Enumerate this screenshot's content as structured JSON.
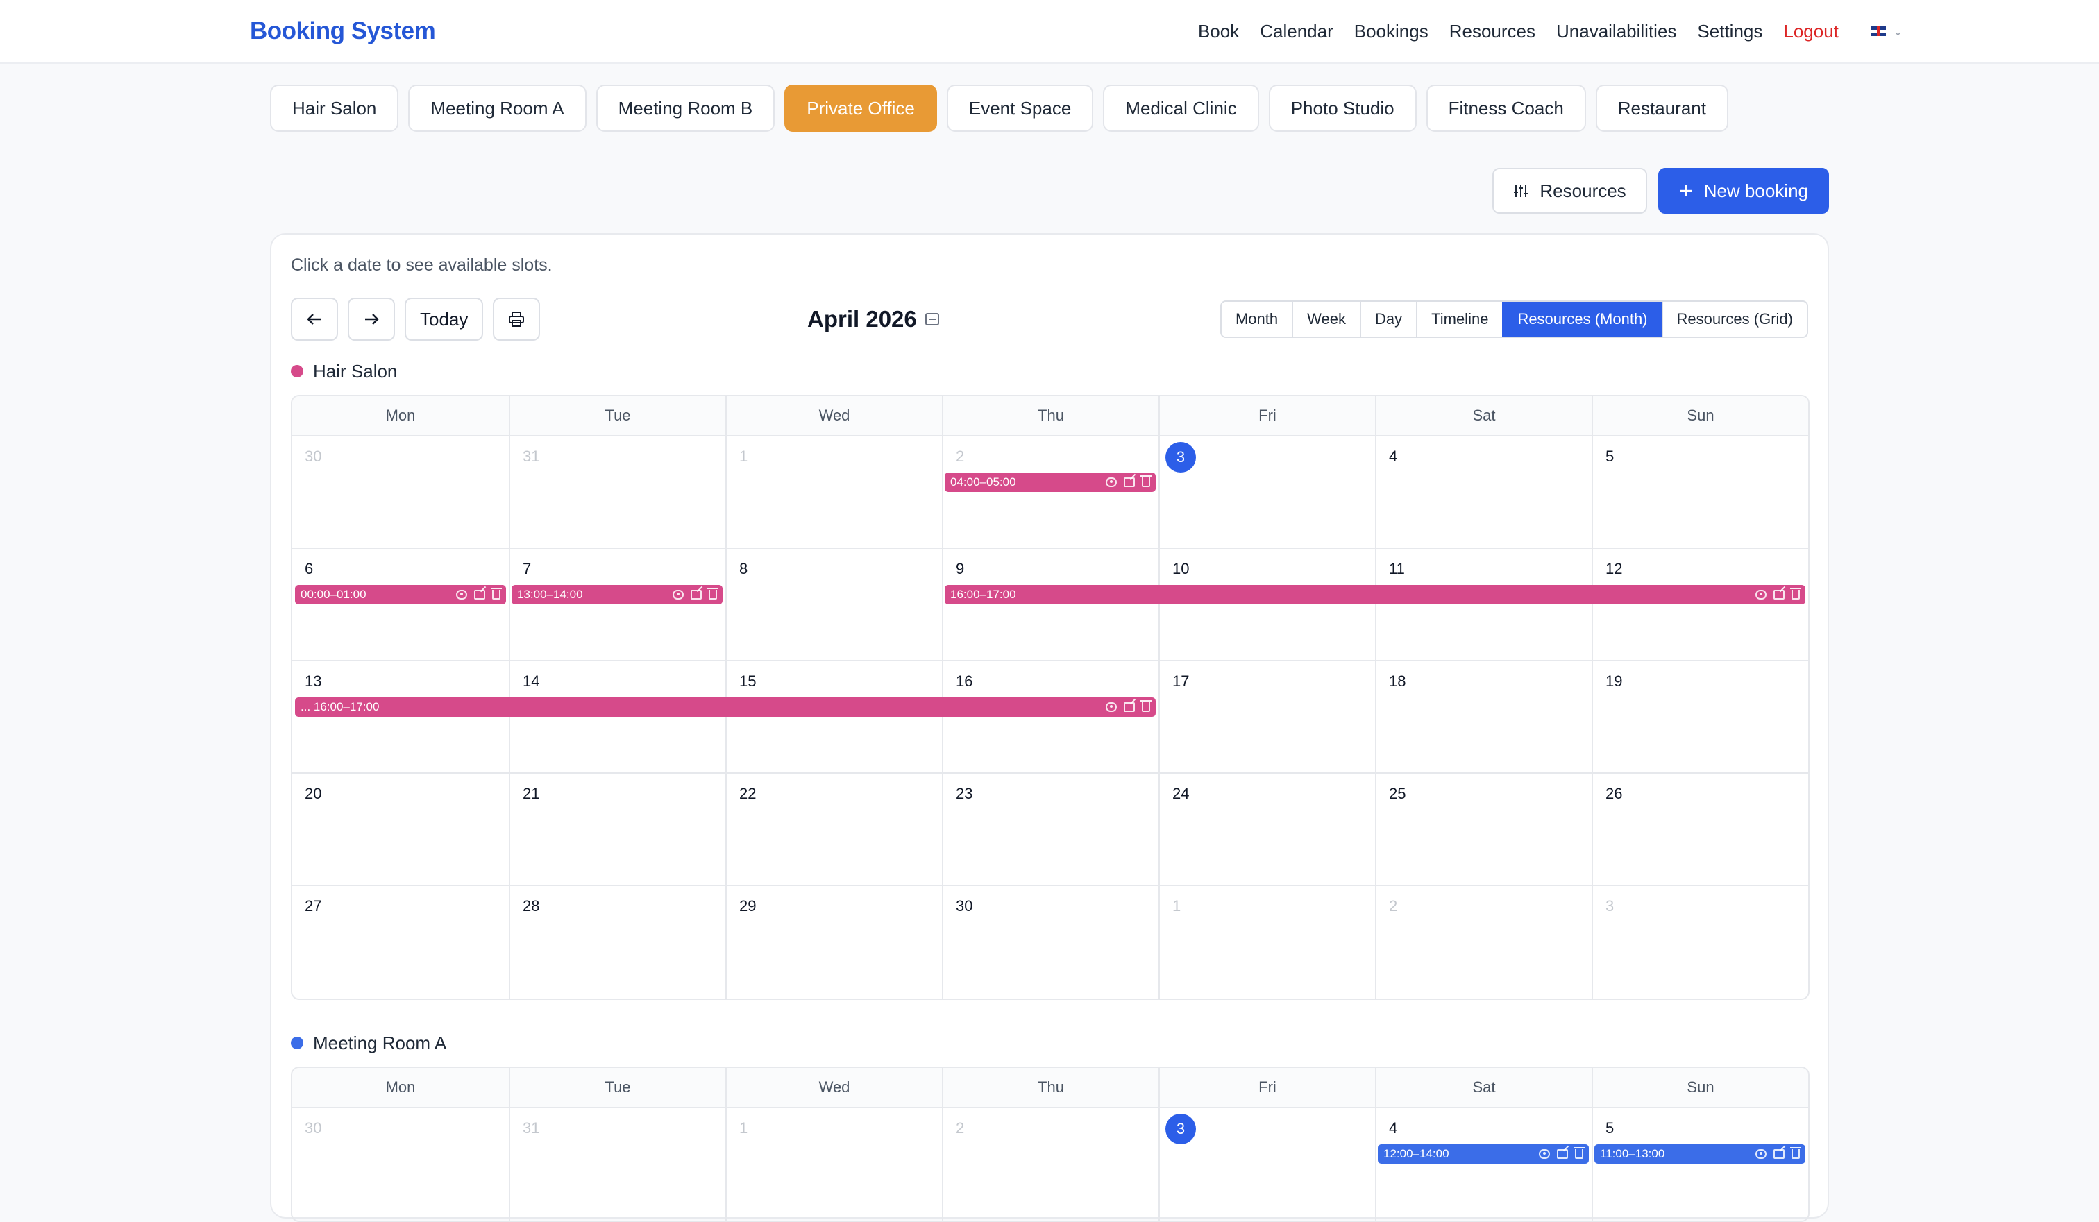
{
  "app": {
    "title": "Booking System"
  },
  "nav": {
    "links": [
      "Book",
      "Calendar",
      "Bookings",
      "Resources",
      "Unavailabilities",
      "Settings"
    ],
    "logout": "Logout"
  },
  "categories": [
    "Hair Salon",
    "Meeting Room A",
    "Meeting Room B",
    "Private Office",
    "Event Space",
    "Medical Clinic",
    "Photo Studio",
    "Fitness Coach",
    "Restaurant"
  ],
  "active_category": "Private Office",
  "actions": {
    "resources": "Resources",
    "new_booking": "New booking"
  },
  "calendar": {
    "hint": "Click a date to see available slots.",
    "today_label": "Today",
    "title": "April 2026",
    "views": [
      "Month",
      "Week",
      "Day",
      "Timeline",
      "Resources (Month)",
      "Resources (Grid)"
    ],
    "active_view": "Resources (Month)",
    "weekdays": [
      "Mon",
      "Tue",
      "Wed",
      "Thu",
      "Fri",
      "Sat",
      "Sun"
    ]
  },
  "colors": {
    "primary": "#2c5ee8",
    "accent": "#e89a35",
    "hair_salon": "#d64a8a",
    "meeting_room_a": "#3b6de8",
    "logout": "#dc2626"
  },
  "resources": [
    {
      "name": "Hair Salon",
      "color": "#d64a8a",
      "weeks": [
        [
          {
            "d": "30",
            "m": true
          },
          {
            "d": "31",
            "m": true
          },
          {
            "d": "1",
            "m": true
          },
          {
            "d": "2",
            "m": true
          },
          {
            "d": "3",
            "t": true
          },
          {
            "d": "4"
          },
          {
            "d": "5"
          }
        ],
        [
          {
            "d": "6"
          },
          {
            "d": "7"
          },
          {
            "d": "8"
          },
          {
            "d": "9"
          },
          {
            "d": "10"
          },
          {
            "d": "11"
          },
          {
            "d": "12"
          }
        ],
        [
          {
            "d": "13"
          },
          {
            "d": "14"
          },
          {
            "d": "15"
          },
          {
            "d": "16"
          },
          {
            "d": "17"
          },
          {
            "d": "18"
          },
          {
            "d": "19"
          }
        ],
        [
          {
            "d": "20"
          },
          {
            "d": "21"
          },
          {
            "d": "22"
          },
          {
            "d": "23"
          },
          {
            "d": "24"
          },
          {
            "d": "25"
          },
          {
            "d": "26"
          }
        ],
        [
          {
            "d": "27"
          },
          {
            "d": "28"
          },
          {
            "d": "29"
          },
          {
            "d": "30"
          },
          {
            "d": "1",
            "m": true
          },
          {
            "d": "2",
            "m": true
          },
          {
            "d": "3",
            "m": true
          }
        ]
      ],
      "events": [
        {
          "week": 0,
          "start": 3,
          "span": 1,
          "label": "04:00–05:00"
        },
        {
          "week": 1,
          "start": 0,
          "span": 1,
          "label": "00:00–01:00"
        },
        {
          "week": 1,
          "start": 1,
          "span": 1,
          "label": "13:00–14:00"
        },
        {
          "week": 1,
          "start": 3,
          "span": 4,
          "label": "16:00–17:00"
        },
        {
          "week": 2,
          "start": 0,
          "span": 4,
          "label": "... 16:00–17:00"
        }
      ]
    },
    {
      "name": "Meeting Room A",
      "color": "#3b6de8",
      "weeks": [
        [
          {
            "d": "30",
            "m": true
          },
          {
            "d": "31",
            "m": true
          },
          {
            "d": "1",
            "m": true
          },
          {
            "d": "2",
            "m": true
          },
          {
            "d": "3",
            "t": true
          },
          {
            "d": "4"
          },
          {
            "d": "5"
          }
        ]
      ],
      "events": [
        {
          "week": 0,
          "start": 5,
          "span": 1,
          "label": "12:00–14:00"
        },
        {
          "week": 0,
          "start": 6,
          "span": 1,
          "label": "11:00–13:00"
        }
      ]
    }
  ]
}
